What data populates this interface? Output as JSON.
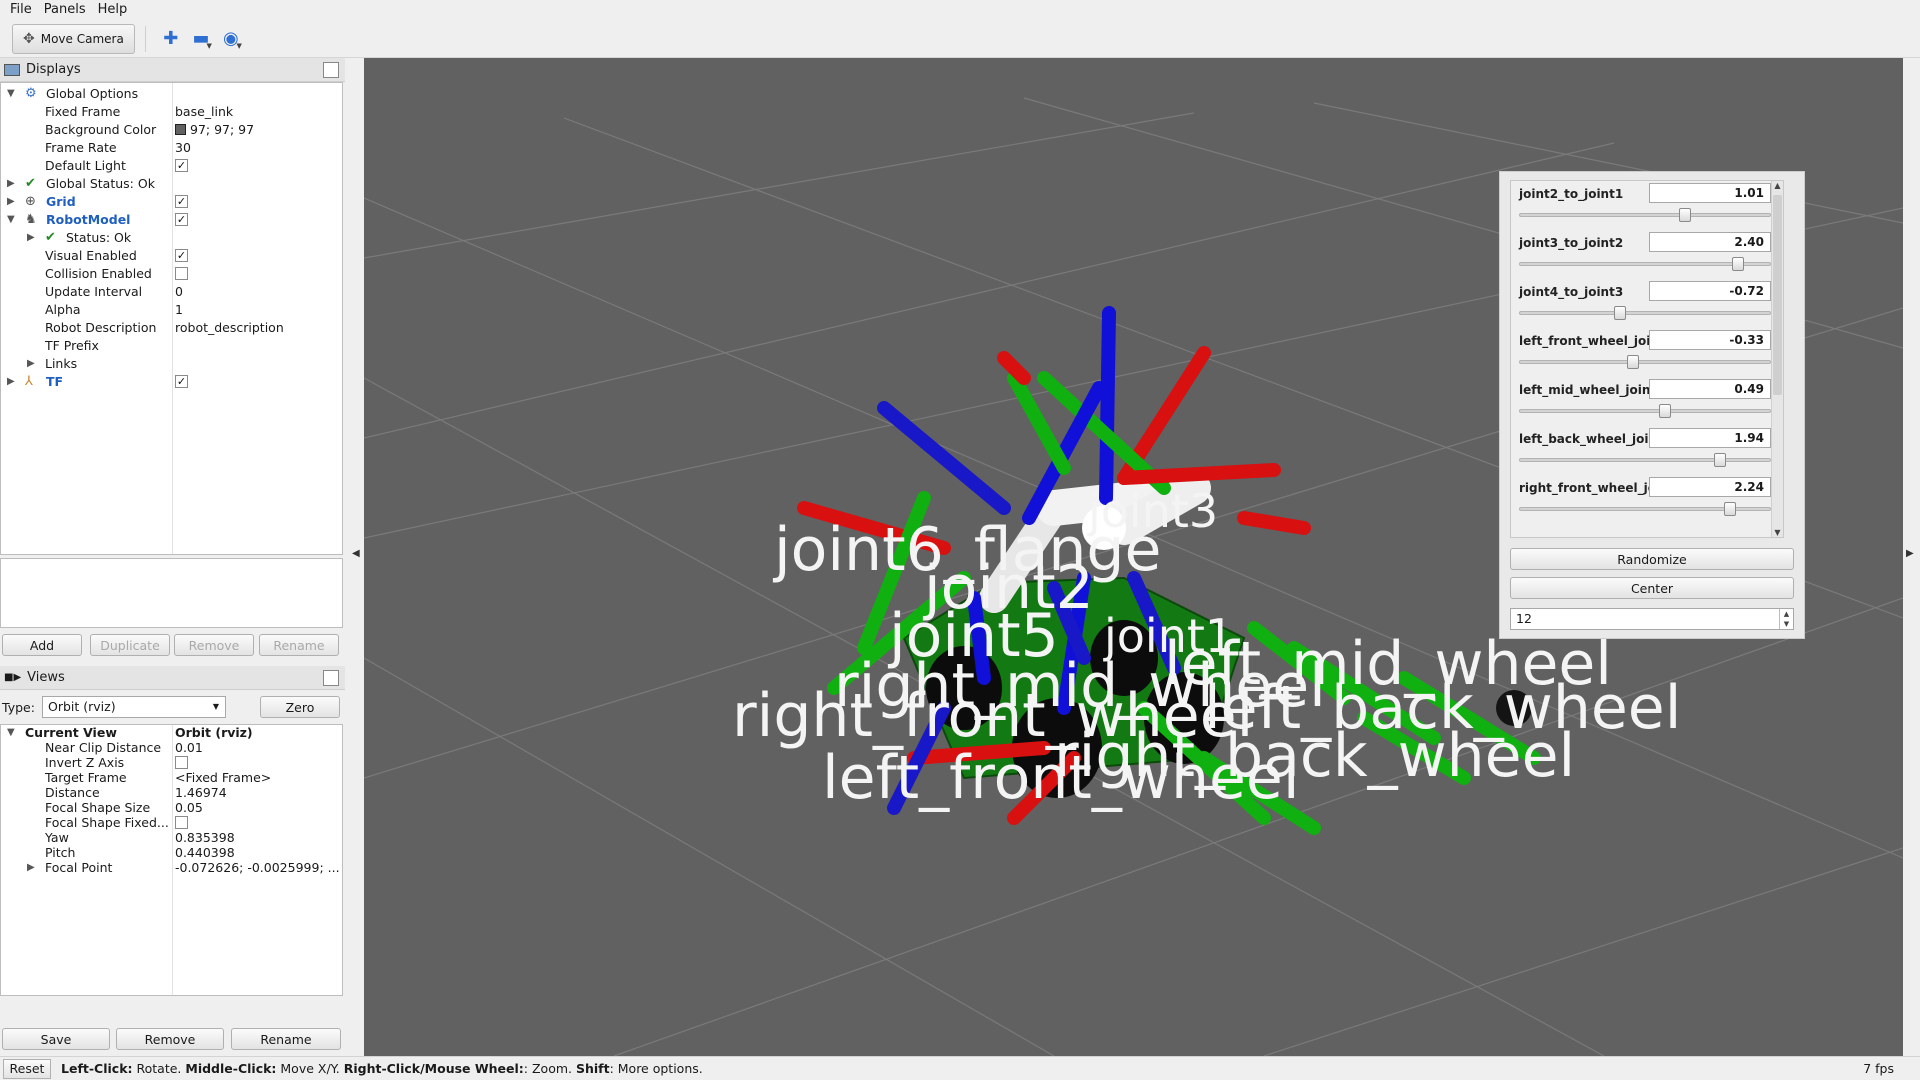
{
  "menu": [
    "File",
    "Panels",
    "Help"
  ],
  "toolbar": {
    "move_camera": "Move Camera",
    "icons": [
      "interact-icon",
      "add-icon",
      "remove-icon",
      "camera-type-icon"
    ]
  },
  "displays": {
    "title": "Displays",
    "rows": [
      {
        "label": "Global Options",
        "value": "",
        "kind": "group",
        "expanded": true
      },
      {
        "label": "Fixed Frame",
        "value": "base_link"
      },
      {
        "label": "Background Color",
        "value": "97; 97; 97"
      },
      {
        "label": "Frame Rate",
        "value": "30"
      },
      {
        "label": "Default Light",
        "checked": true
      },
      {
        "label": "Global Status: Ok"
      },
      {
        "label": "Grid",
        "checked": true
      },
      {
        "label": "RobotModel",
        "checked": true
      },
      {
        "label": "Status: Ok"
      },
      {
        "label": "Visual Enabled",
        "checked": true
      },
      {
        "label": "Collision Enabled",
        "checked": false
      },
      {
        "label": "Update Interval",
        "value": "0"
      },
      {
        "label": "Alpha",
        "value": "1"
      },
      {
        "label": "Robot Description",
        "value": "robot_description"
      },
      {
        "label": "TF Prefix",
        "value": ""
      },
      {
        "label": "Links"
      },
      {
        "label": "TF",
        "checked": true
      }
    ],
    "buttons": {
      "add": "Add",
      "duplicate": "Duplicate",
      "remove": "Remove",
      "rename": "Rename"
    }
  },
  "views": {
    "title": "Views",
    "type_label": "Type:",
    "type_value": "Orbit (rviz)",
    "zero": "Zero",
    "rows": [
      {
        "label": "Current View",
        "value": "Orbit (rviz)"
      },
      {
        "label": "Near Clip Distance",
        "value": "0.01"
      },
      {
        "label": "Invert Z Axis",
        "checked": false
      },
      {
        "label": "Target Frame",
        "value": "<Fixed Frame>"
      },
      {
        "label": "Distance",
        "value": "1.46974"
      },
      {
        "label": "Focal Shape Size",
        "value": "0.05"
      },
      {
        "label": "Focal Shape Fixed...",
        "checked": false
      },
      {
        "label": "Yaw",
        "value": "0.835398"
      },
      {
        "label": "Pitch",
        "value": "0.440398"
      },
      {
        "label": "Focal Point",
        "value": "-0.072626; -0.0025999; ..."
      }
    ],
    "buttons": {
      "save": "Save",
      "remove": "Remove",
      "rename": "Rename"
    }
  },
  "joints": [
    {
      "name": "joint2_to_joint1",
      "value": "1.01",
      "fraction": 0.66
    },
    {
      "name": "joint3_to_joint2",
      "value": "2.40",
      "fraction": 0.87
    },
    {
      "name": "joint4_to_joint3",
      "value": "-0.72",
      "fraction": 0.4
    },
    {
      "name": "left_front_wheel_joint",
      "value": "-0.33",
      "fraction": 0.45
    },
    {
      "name": "left_mid_wheel_joint",
      "value": "0.49",
      "fraction": 0.58
    },
    {
      "name": "left_back_wheel_joint",
      "value": "1.94",
      "fraction": 0.8
    },
    {
      "name": "right_front_wheel_joint",
      "value": "2.24",
      "fraction": 0.84
    }
  ],
  "joint_panel": {
    "randomize": "Randomize",
    "center": "Center",
    "count": "12"
  },
  "scene_labels": [
    "joint3",
    "joint6_flange",
    "joint2",
    "joint5",
    "joint1",
    "right_mid_wheel",
    "right_front_wheel",
    "right_back_wheel",
    "left_front_wheel",
    "left_mid_wheel",
    "left_back_wheel"
  ],
  "status": {
    "reset": "Reset",
    "segments": [
      {
        "text": "Left-Click:",
        "bold": true
      },
      {
        "text": " Rotate. ",
        "bold": false
      },
      {
        "text": "Middle-Click:",
        "bold": true
      },
      {
        "text": " Move X/Y. ",
        "bold": false
      },
      {
        "text": "Right-Click/Mouse Wheel:",
        "bold": true
      },
      {
        "text": ": Zoom. ",
        "bold": false
      },
      {
        "text": "Shift",
        "bold": true
      },
      {
        "text": ": More options.",
        "bold": false
      }
    ],
    "fps": "7 fps"
  }
}
